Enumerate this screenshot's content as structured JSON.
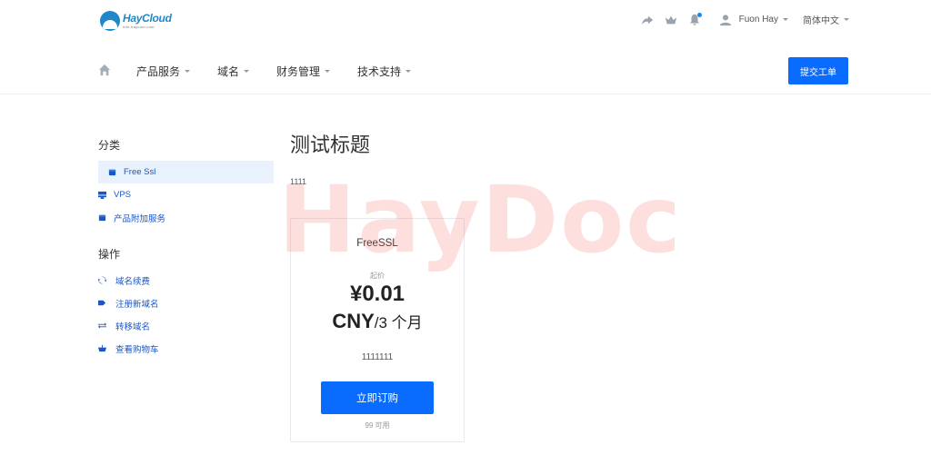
{
  "brand": {
    "name": "HayCloud",
    "tagline": "info.haycom.com",
    "color": "#1e88c9"
  },
  "topbar": {
    "icons": [
      "share-icon",
      "bird-icon",
      "bell-icon"
    ],
    "user_name": "Fuon Hay",
    "language": "简体中文"
  },
  "nav": {
    "items": [
      {
        "label": "产品服务"
      },
      {
        "label": "域名"
      },
      {
        "label": "财务管理"
      },
      {
        "label": "技术支持"
      }
    ],
    "submit_ticket": "提交工单"
  },
  "sidebar": {
    "categories_heading": "分类",
    "categories": [
      {
        "label": "Free Ssl",
        "icon": "box-icon",
        "active": true
      },
      {
        "label": "VPS",
        "icon": "server-icon",
        "active": false
      },
      {
        "label": "产品附加服务",
        "icon": "box-icon",
        "active": false
      }
    ],
    "actions_heading": "操作",
    "actions": [
      {
        "label": "域名续费",
        "icon": "refresh-icon"
      },
      {
        "label": "注册新域名",
        "icon": "tag-icon"
      },
      {
        "label": "转移域名",
        "icon": "transfer-icon"
      },
      {
        "label": "查看购物车",
        "icon": "basket-icon"
      }
    ]
  },
  "main": {
    "title": "测试标题",
    "description": "1111"
  },
  "product": {
    "name": "FreeSSL",
    "from_label": "起价",
    "price": "¥0.01",
    "currency": "CNY",
    "period": "/3 个月",
    "description": "1111111",
    "buy_label": "立即订购",
    "stock": "99 可用"
  },
  "watermark": "HayDoc",
  "colors": {
    "accent": "#0a6cff",
    "link": "#1a56c6",
    "active_bg": "#e8f1fc",
    "watermark": "#f56e64"
  }
}
